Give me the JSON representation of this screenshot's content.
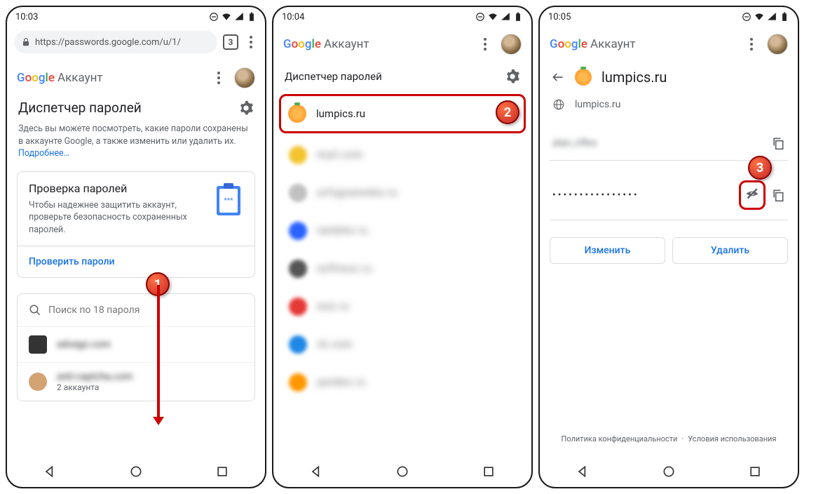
{
  "phone1": {
    "time": "10:03",
    "url": "https://passwords.google.com/u/1/",
    "tabcount": "3",
    "brand": "Google",
    "account": "Аккаунт",
    "section_title": "Диспетчер паролей",
    "desc": "Здесь вы можете посмотреть, какие пароли сохранены в аккаунте Google, а также изменить или удалить их.",
    "more": "Подробнее…",
    "card_title": "Проверка паролей",
    "card_desc": "Чтобы надежнее защитить аккаунт, проверьте безопасность сохраненных паролей.",
    "card_action": "Проверить пароли",
    "search_placeholder": "Поиск по 18 пароля",
    "row1": "advego.com",
    "row2": "anti-captcha.com",
    "row2_sub": "2 аккаунта",
    "badge": "1"
  },
  "phone2": {
    "time": "10:04",
    "brand": "Google",
    "account": "Аккаунт",
    "section_title": "Диспетчер паролей",
    "highlighted_site": "lumpics.ru",
    "badge": "2",
    "rows": [
      {
        "color": "#f4c430",
        "text": "mail.com"
      },
      {
        "color": "#c0c0c0",
        "text": "orfogrammka.ru"
      },
      {
        "color": "#2962ff",
        "text": "rambler.ru"
      },
      {
        "color": "#555",
        "text": "softreus.ru"
      },
      {
        "color": "#e53935",
        "text": "text.ru"
      },
      {
        "color": "#1e88e5",
        "text": "vk.com"
      },
      {
        "color": "#ff9800",
        "text": "yandex.ru"
      }
    ]
  },
  "phone3": {
    "time": "10:05",
    "brand": "Google",
    "account": "Аккаунт",
    "site_title": "lumpics.ru",
    "domain": "lumpics.ru",
    "username": "alan_rifles",
    "password_mask": "••••••••••••••••",
    "badge": "3",
    "btn_edit": "Изменить",
    "btn_delete": "Удалить",
    "privacy": "Политика конфиденциальности",
    "terms": "Условия использования"
  }
}
